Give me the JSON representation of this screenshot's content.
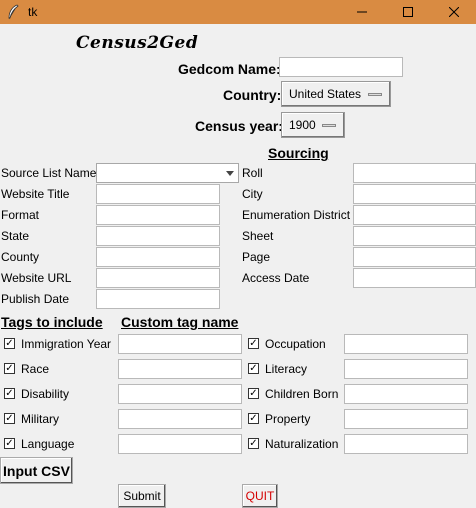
{
  "window": {
    "title": "tk"
  },
  "app": {
    "logo": "Census2Ged"
  },
  "header": {
    "gedcom_label": "Gedcom Name:",
    "gedcom_value": "",
    "country_label": "Country:",
    "country_value": "United States",
    "census_year_label": "Census year:",
    "census_year_value": "1900"
  },
  "sourcing": {
    "heading": "Sourcing",
    "left_fields": [
      {
        "label": "Source List Name",
        "value": ""
      },
      {
        "label": "Website Title",
        "value": ""
      },
      {
        "label": "Format",
        "value": ""
      },
      {
        "label": "State",
        "value": ""
      },
      {
        "label": "County",
        "value": ""
      },
      {
        "label": "Website URL",
        "value": ""
      },
      {
        "label": "Publish Date",
        "value": ""
      }
    ],
    "right_fields": [
      {
        "label": "Roll",
        "value": ""
      },
      {
        "label": "City",
        "value": ""
      },
      {
        "label": "Enumeration District",
        "value": ""
      },
      {
        "label": "Sheet",
        "value": ""
      },
      {
        "label": "Page",
        "value": ""
      },
      {
        "label": "Access Date",
        "value": ""
      }
    ]
  },
  "tags": {
    "include_heading": "Tags to include",
    "custom_heading": "Custom tag name",
    "left": [
      {
        "label": "Immigration Year",
        "checked": true,
        "custom": ""
      },
      {
        "label": "Race",
        "checked": true,
        "custom": ""
      },
      {
        "label": "Disability",
        "checked": true,
        "custom": ""
      },
      {
        "label": "Military",
        "checked": true,
        "custom": ""
      },
      {
        "label": "Language",
        "checked": true,
        "custom": ""
      }
    ],
    "right": [
      {
        "label": "Occupation",
        "checked": true,
        "custom": ""
      },
      {
        "label": "Literacy",
        "checked": true,
        "custom": ""
      },
      {
        "label": "Children Born",
        "checked": true,
        "custom": ""
      },
      {
        "label": "Property",
        "checked": true,
        "custom": ""
      },
      {
        "label": "Naturalization",
        "checked": true,
        "custom": ""
      }
    ]
  },
  "actions": {
    "input_csv": "Input CSV",
    "submit": "Submit",
    "quit": "QUIT"
  },
  "colors": {
    "titlebar": "#d98b42",
    "quit_text": "#d40000"
  }
}
